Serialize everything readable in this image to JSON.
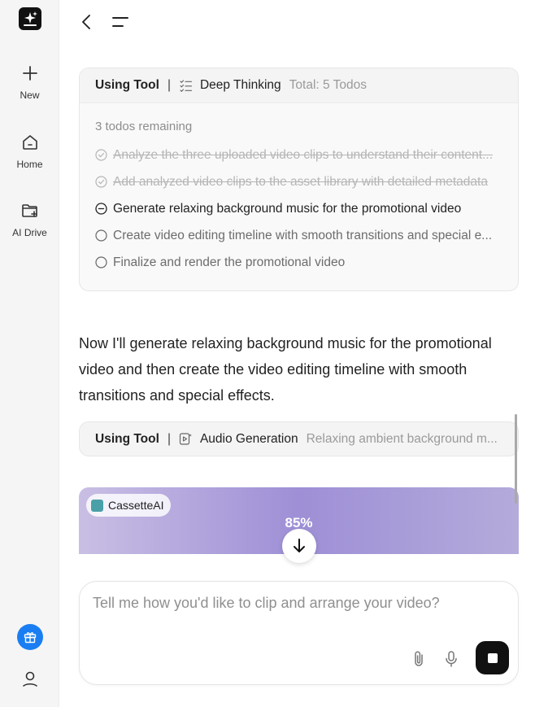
{
  "sidebar": {
    "items": [
      {
        "label": "New",
        "icon": "plus-icon"
      },
      {
        "label": "Home",
        "icon": "home-icon"
      },
      {
        "label": "AI Drive",
        "icon": "folder-plus-icon"
      }
    ]
  },
  "todo_tool": {
    "using_label": "Using Tool",
    "separator": "|",
    "tool_name": "Deep Thinking",
    "meta": "Total: 5 Todos",
    "remaining": "3 todos remaining",
    "todos": [
      {
        "text": "Analyze the three uploaded video clips to understand their content...",
        "status": "done"
      },
      {
        "text": "Add analyzed video clips to the asset library with detailed metadata",
        "status": "done"
      },
      {
        "text": "Generate relaxing background music for the promotional video",
        "status": "active"
      },
      {
        "text": "Create video editing timeline with smooth transitions and special e...",
        "status": "pending"
      },
      {
        "text": "Finalize and render the promotional video",
        "status": "pending"
      }
    ]
  },
  "message": "Now I'll generate relaxing background music for the promotional video and then create the video editing timeline with smooth transitions and special effects.",
  "audio_tool": {
    "using_label": "Using Tool",
    "separator": "|",
    "tool_name": "Audio Generation",
    "meta": "Relaxing ambient background m..."
  },
  "music_card": {
    "badge": "CassetteAI",
    "progress_label": "85%",
    "progress": 85
  },
  "composer": {
    "placeholder": "Tell me how you'd like to clip and arrange your video?"
  },
  "colors": {
    "accent": "#1a7ef2",
    "stop_button": "#111111"
  }
}
